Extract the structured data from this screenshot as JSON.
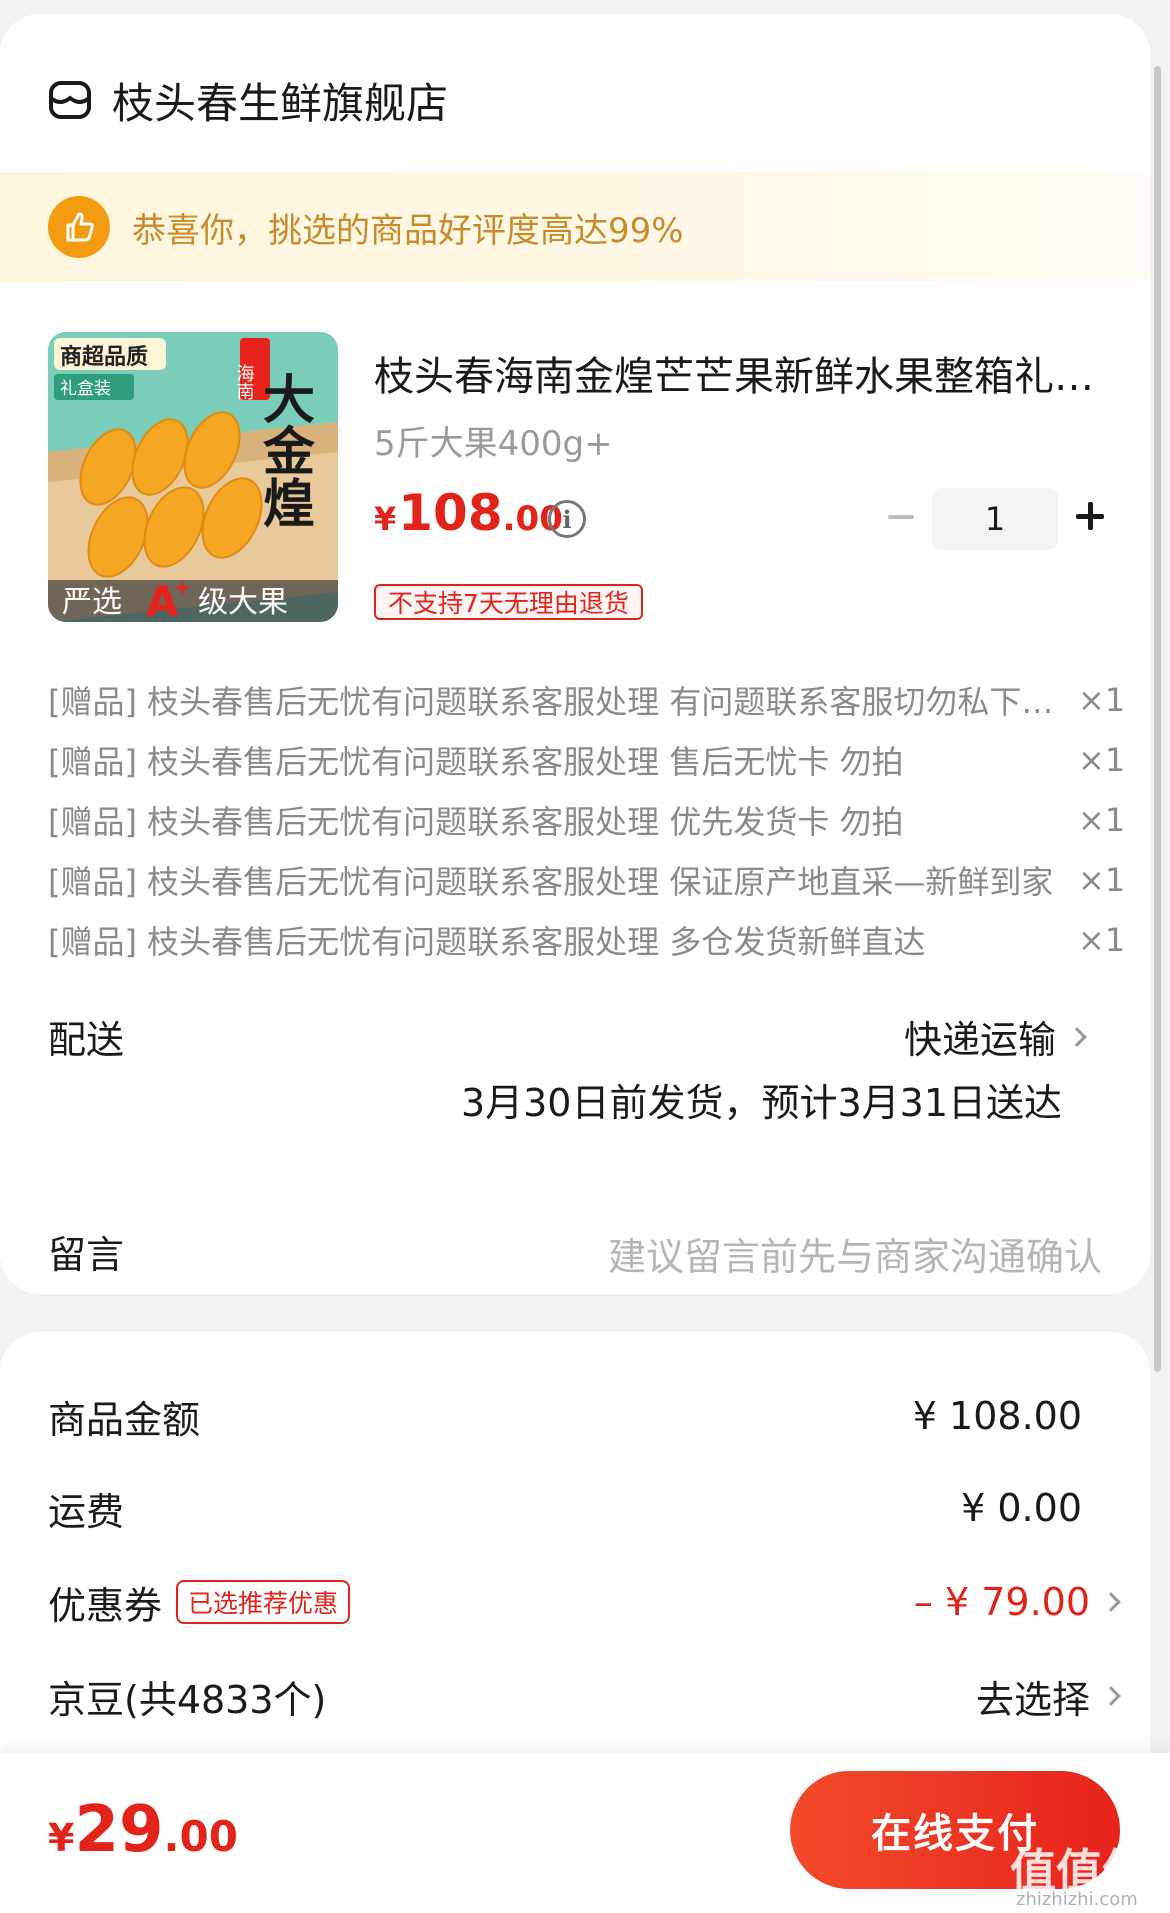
{
  "store": {
    "name": "枝头春生鲜旗舰店",
    "icon": "store-icon"
  },
  "banner": {
    "text": "恭喜你，挑选的商品好评度高达99%",
    "icon": "thumbs-up-icon"
  },
  "product": {
    "title": "枝头春海南金煌芒芒果新鲜水果整箱礼盒装",
    "spec": "5斤大果400g+",
    "price": {
      "currency": "¥",
      "integer": "108",
      "decimal": ".00"
    },
    "return_tag": "不支持7天无理由退货",
    "quantity": "1",
    "image": {
      "badge": "商超品质",
      "sub_badge": "礼盒装",
      "seal": "海南",
      "big_text": "大金煌",
      "bottom_text_1": "严选",
      "grade": "A",
      "grade_mark": "+",
      "bottom_text_2": "级大果"
    }
  },
  "gifts": [
    {
      "name": "[赠品] 枝头春售后无忧有问题联系客服处理 有问题联系客服切勿私下处理",
      "qty": "×1"
    },
    {
      "name": "[赠品] 枝头春售后无忧有问题联系客服处理 售后无忧卡 勿拍",
      "qty": "×1"
    },
    {
      "name": "[赠品] 枝头春售后无忧有问题联系客服处理 优先发货卡 勿拍",
      "qty": "×1"
    },
    {
      "name": "[赠品] 枝头春售后无忧有问题联系客服处理 保证原产地直采—新鲜到家",
      "qty": "×1"
    },
    {
      "name": "[赠品] 枝头春售后无忧有问题联系客服处理 多仓发货新鲜直达",
      "qty": "×1"
    }
  ],
  "shipping": {
    "label": "配送",
    "method": "快递运输",
    "date": "3月30日前发货，预计3月31日送达"
  },
  "message": {
    "label": "留言",
    "placeholder": "建议留言前先与商家沟通确认"
  },
  "fees": {
    "goods": {
      "label": "商品金额",
      "value": "¥ 108.00"
    },
    "freight": {
      "label": "运费",
      "value": "¥ 0.00"
    },
    "coupon": {
      "label": "优惠券",
      "tag": "已选推荐优惠",
      "value": "– ¥ 79.00"
    },
    "jingdou": {
      "label": "京豆(共4833个)",
      "value": "去选择"
    }
  },
  "footer": {
    "total": {
      "currency": "¥",
      "integer": "29",
      "decimal": ".00"
    },
    "pay_button": "在线支付",
    "watermark": "值值值",
    "watermark_url": "zhizhizhi.com"
  },
  "colors": {
    "accent": "#e2231a",
    "banner_text": "#c88a2a",
    "banner_icon": "#f39c12"
  }
}
